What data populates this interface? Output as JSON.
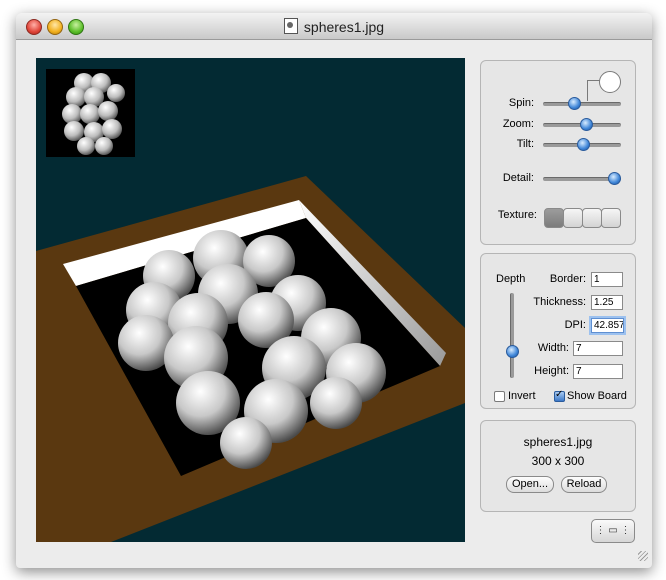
{
  "window": {
    "title": "spheres1.jpg"
  },
  "controls": {
    "spin_label": "Spin:",
    "zoom_label": "Zoom:",
    "tilt_label": "Tilt:",
    "detail_label": "Detail:",
    "texture_label": "Texture:",
    "spin_value": 0.38,
    "zoom_value": 0.55,
    "tilt_value": 0.5,
    "detail_value": 0.97,
    "texture_selected_index": 0
  },
  "board": {
    "depth_label": "Depth",
    "depth_value": 0.3,
    "border_label": "Border:",
    "border_value": "1",
    "thickness_label": "Thickness:",
    "thickness_value": "1.25",
    "dpi_label": "DPI:",
    "dpi_value": "42.85714",
    "width_label": "Width:",
    "width_value": "7",
    "height_label": "Height:",
    "height_value": "7",
    "invert_label": "Invert",
    "invert_checked": false,
    "show_board_label": "Show Board",
    "show_board_checked": true
  },
  "file": {
    "name": "spheres1.jpg",
    "dimensions": "300 x 300",
    "open_button": "Open...",
    "reload_button": "Reload"
  },
  "colors": {
    "viewport_bg": "#032a33",
    "board_brown": "#5a3810",
    "accent_blue": "#3f86d8"
  }
}
